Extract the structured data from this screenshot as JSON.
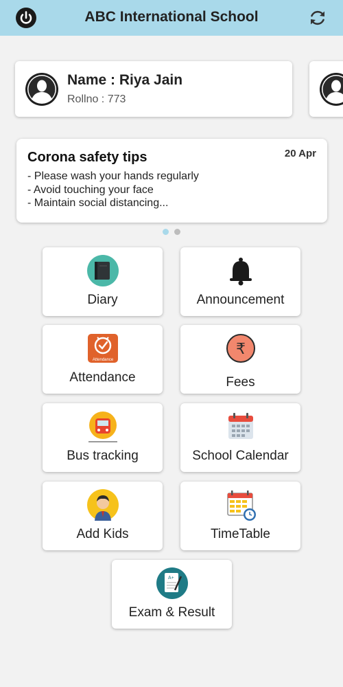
{
  "header": {
    "title": "ABC International School",
    "left_icon": "power-icon",
    "right_icon": "refresh-icon"
  },
  "profiles": [
    {
      "name": "Name : Riya Jain",
      "roll": "Rollno : 773"
    }
  ],
  "notice": {
    "title": "Corona safety tips",
    "date": "20 Apr",
    "lines": [
      "- Please wash your hands regularly",
      "- Avoid touching your face",
      "- Maintain social distancing..."
    ]
  },
  "carousel": {
    "pages": 2,
    "active": 1
  },
  "menu": {
    "diary": "Diary",
    "announcement": "Announcement",
    "attendance": "Attendance",
    "fees": "Fees",
    "bus_tracking": "Bus tracking",
    "school_calendar": "School Calendar",
    "add_kids": "Add Kids",
    "timetable": "TimeTable",
    "exam_result": "Exam & Result"
  },
  "icon_labels": {
    "attendance_badge": "Attendance",
    "rupee": "₹",
    "exam_badge": "A+"
  },
  "colors": {
    "header_bg": "#a9d9ea",
    "page_bg": "#f2f2f2",
    "dot_active": "#a9d9ea",
    "dot_inactive": "#bdbdbd"
  }
}
